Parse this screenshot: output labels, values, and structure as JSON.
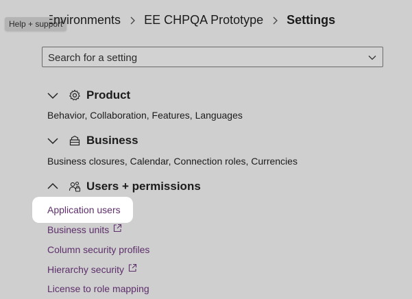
{
  "tooltip": {
    "text": "Help + support"
  },
  "breadcrumb": {
    "items": [
      "Environments",
      "EE CHPQA Prototype",
      "Settings"
    ]
  },
  "search": {
    "placeholder": "Search for a setting"
  },
  "sections": [
    {
      "title": "Product",
      "icon": "gear-icon",
      "state": "collapsed",
      "description": "Behavior, Collaboration, Features, Languages"
    },
    {
      "title": "Business",
      "icon": "business-icon",
      "state": "collapsed",
      "description": "Business closures, Calendar, Connection roles, Currencies"
    },
    {
      "title": "Users + permissions",
      "icon": "users-permissions-icon",
      "state": "expanded",
      "items": [
        {
          "label": "Application users",
          "external": false,
          "highlighted": true
        },
        {
          "label": "Business units",
          "external": true
        },
        {
          "label": "Column security profiles",
          "external": false
        },
        {
          "label": "Hierarchy security",
          "external": true
        },
        {
          "label": "License to role mapping",
          "external": false
        }
      ]
    }
  ],
  "colors": {
    "background": "#cfcfcf",
    "link": "#5c2e6a",
    "highlight": "#ffffff"
  }
}
